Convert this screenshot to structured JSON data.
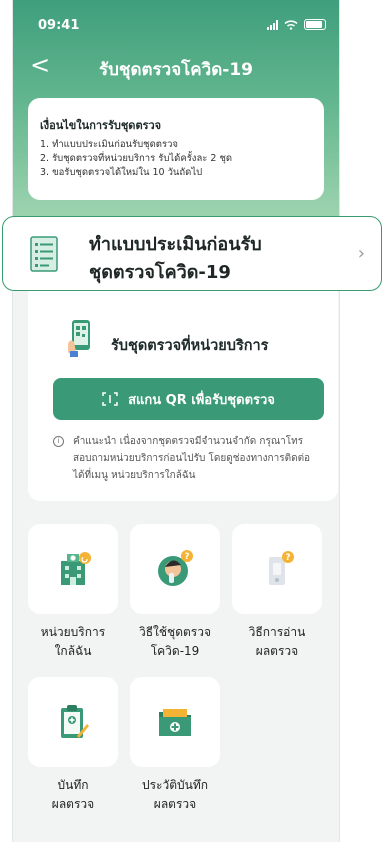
{
  "status": {
    "time": "09:41"
  },
  "nav": {
    "back_symbol": "<",
    "title": "รับชุดตรวจโควิด-19"
  },
  "conditions": {
    "heading": "เงื่อนไขในการรับชุดตรวจ",
    "items": [
      "1. ทำแบบประเมินก่อนรับชุดตรวจ",
      "2. รับชุดตรวจที่หน่วยบริการ รับได้ครั้งละ 2 ชุด",
      "3. ขอรับชุดตรวจได้ใหม่ใน 10 วันถัดไป"
    ]
  },
  "assessment": {
    "line1": "ทำแบบประเมินก่อนรับ",
    "line2": "ชุดตรวจโควิด-19",
    "chevron": "›"
  },
  "pickup": {
    "title": "รับชุดตรวจที่หน่วยบริการ",
    "scan_button": "สแกน QR เพื่อรับชุดตรวจ",
    "note_icon": "i",
    "note": "คำแนะนำ เนื่องจากชุดตรวจมีจำนวนจำกัด กรุณาโทรสอบถามหน่วยบริการก่อนไปรับ โดยดูช่องทางการติดต่อได้ที่เมนู หน่วยบริการใกล้ฉัน"
  },
  "menu": [
    {
      "icon": "hospital-icon",
      "line1": "หน่วยบริการ",
      "line2": "ใกล้ฉัน"
    },
    {
      "icon": "person-question-icon",
      "line1": "วิธีใช้ชุดตรวจ",
      "line2": "โควิด-19"
    },
    {
      "icon": "test-kit-question-icon",
      "line1": "วิธีการอ่าน",
      "line2": "ผลตรวจ"
    },
    {
      "icon": "clipboard-pen-icon",
      "line1": "บันทึก",
      "line2": "ผลตรวจ"
    },
    {
      "icon": "folder-plus-icon",
      "line1": "ประวัติบันทึก",
      "line2": "ผลตรวจ"
    }
  ],
  "colors": {
    "primary": "#3a9a78",
    "accent": "#f5b335"
  }
}
